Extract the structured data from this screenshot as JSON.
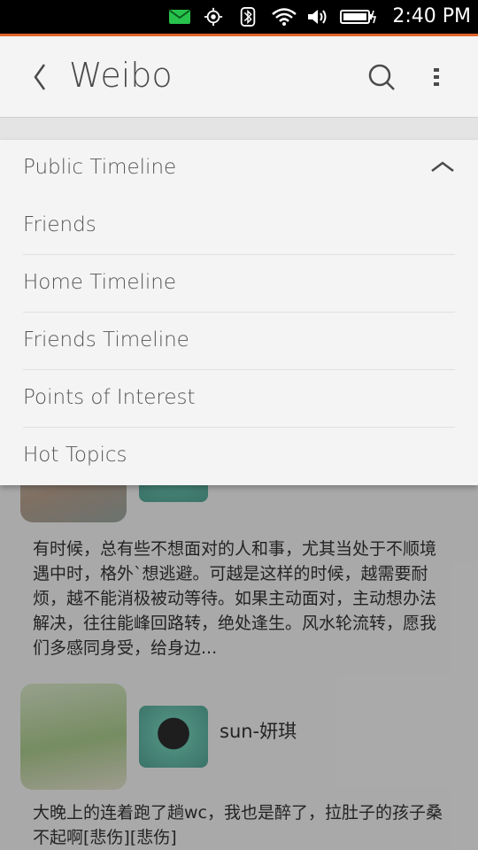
{
  "status_bar": {
    "time": "2:40 PM",
    "icons": [
      "message-icon",
      "location-icon",
      "bluetooth-icon",
      "wifi-icon",
      "volume-icon",
      "battery-icon"
    ]
  },
  "header": {
    "title": "Weibo",
    "back_icon": "chevron-left-icon",
    "search_icon": "search-icon",
    "menu_icon": "more-vertical-icon"
  },
  "dropdown": {
    "selected": "Public Timeline",
    "items": [
      {
        "label": "Friends"
      },
      {
        "label": "Home Timeline"
      },
      {
        "label": "Friends Timeline"
      },
      {
        "label": "Points of Interest"
      },
      {
        "label": "Hot Topics"
      }
    ]
  },
  "feed": {
    "posts": [
      {
        "username": "",
        "text": "有时候，总有些不想面对的人和事，尤其当处于不顺境遇中时，格外`想逃避。可越是这样的时候，越需要耐烦，越不能消极被动等待。如果主动面对，主动想办法解决，往往能峰回路转，绝处逢生。风水轮流转，愿我们多感同身受，给身边..."
      },
      {
        "username": "sun-妍琪",
        "text": "大晚上的连着跑了趟wc，我也是醉了，拉肚子的孩子桑不起啊[悲伤][悲伤]"
      }
    ]
  },
  "colors": {
    "accent": "#e0642a",
    "header_bg": "#f4f4f4",
    "text": "#555555"
  }
}
